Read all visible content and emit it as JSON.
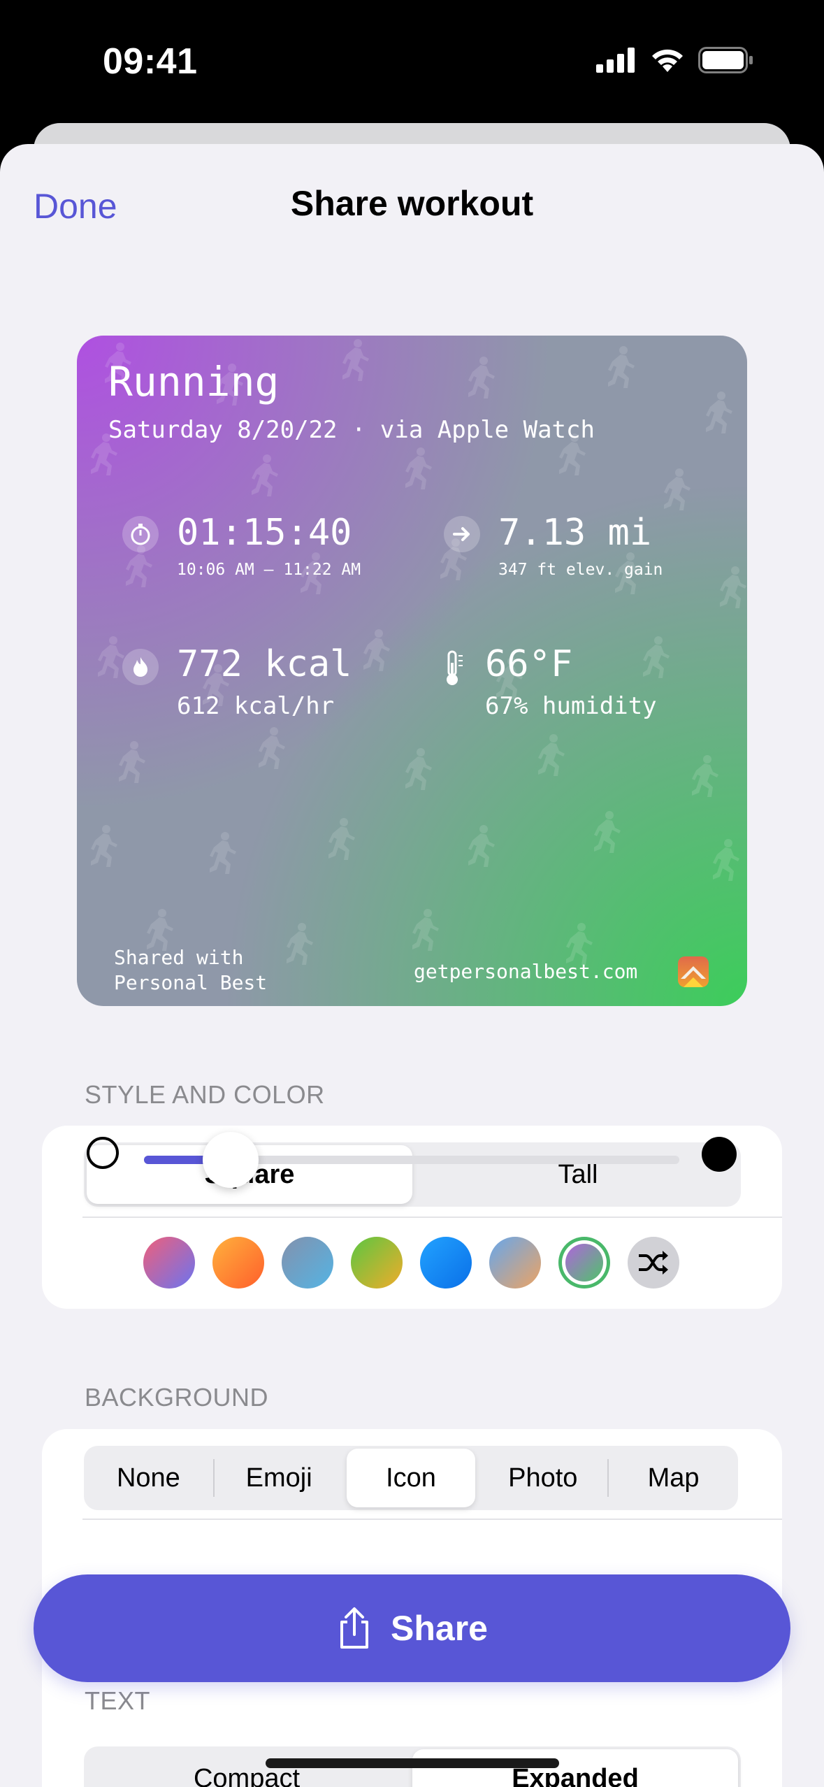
{
  "status_bar": {
    "time": "09:41"
  },
  "nav": {
    "done_label": "Done",
    "title": "Share workout"
  },
  "preview": {
    "activity": "Running",
    "subtitle": "Saturday 8/20/22 · via Apple Watch",
    "duration": "01:15:40",
    "time_range": "10:06 AM – 11:22 AM",
    "distance": "7.13 mi",
    "elevation": "347 ft elev. gain",
    "calories": "772 kcal",
    "calories_rate": "612 kcal/hr",
    "temperature": "66°F",
    "humidity": "67% humidity",
    "footer_left": "Shared with\nPersonal Best",
    "footer_right": "getpersonalbest.com",
    "gradient_colors": [
      "#af50e1",
      "#8f98a9",
      "#3ccd5a"
    ]
  },
  "style_section": {
    "header": "STYLE AND COLOR",
    "shape_options": [
      "Square",
      "Tall"
    ],
    "selected_shape": "Square",
    "swatches": [
      {
        "name": "pink-blue",
        "colors": [
          "#ef5f7a",
          "#6b74f0"
        ]
      },
      {
        "name": "orange",
        "colors": [
          "#ffb13d",
          "#ff6a2b"
        ]
      },
      {
        "name": "slate-blue",
        "colors": [
          "#7f92b4",
          "#59b2e2"
        ]
      },
      {
        "name": "green-yellow",
        "colors": [
          "#6dc63f",
          "#e6b22d"
        ]
      },
      {
        "name": "blue",
        "colors": [
          "#1e99ff",
          "#0a6fe8"
        ]
      },
      {
        "name": "blue-tan",
        "colors": [
          "#6ba4e6",
          "#e9a66a"
        ]
      },
      {
        "name": "purple-green",
        "colors": [
          "#b064dc",
          "#4fc36a"
        ],
        "selected": true
      }
    ],
    "shuffle_icon": "shuffle-icon"
  },
  "background_section": {
    "header": "BACKGROUND",
    "options": [
      "None",
      "Emoji",
      "Icon",
      "Photo",
      "Map"
    ],
    "selected": "Icon",
    "slider_value": 0.11
  },
  "share_button": {
    "label": "Share",
    "icon": "share-icon"
  },
  "text_section": {
    "header": "TEXT",
    "options": [
      "Compact",
      "Expanded"
    ],
    "selected": "Expanded"
  }
}
